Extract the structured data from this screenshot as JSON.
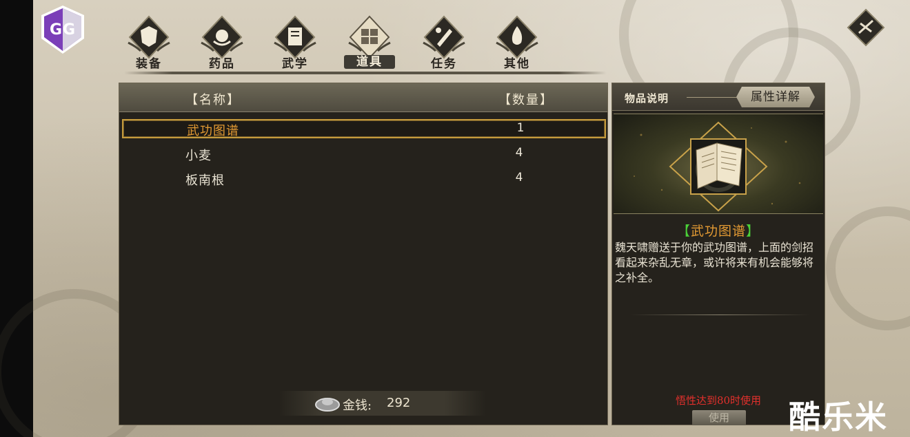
{
  "overlay": {
    "gg_label": "GG"
  },
  "tabs": [
    {
      "label": "装备",
      "icon": "armor-icon",
      "active": false
    },
    {
      "label": "药品",
      "icon": "medicine-icon",
      "active": false
    },
    {
      "label": "武学",
      "icon": "book-icon",
      "active": false
    },
    {
      "label": "道具",
      "icon": "item-box-icon",
      "active": true
    },
    {
      "label": "任务",
      "icon": "scroll-icon",
      "active": false
    },
    {
      "label": "其他",
      "icon": "flame-icon",
      "active": false
    }
  ],
  "list": {
    "name_header": "【名称】",
    "qty_header": "【数量】",
    "rows": [
      {
        "name": "武功图谱",
        "qty": "1",
        "selected": true
      },
      {
        "name": "小麦",
        "qty": "4",
        "selected": false
      },
      {
        "name": "板南根",
        "qty": "4",
        "selected": false
      }
    ]
  },
  "money": {
    "label": "金钱:",
    "value": "292"
  },
  "detail": {
    "tab_desc": "物品说明",
    "tab_attr": "属性详解",
    "item_name": "武功图谱",
    "bracket_left": "【",
    "bracket_right": "】",
    "description": "魏天啸赠送于你的武功图谱，上面的剑招看起来杂乱无章，或许将来有机会能够将之补全。",
    "requirement": "悟性达到80时使用",
    "use_label": "使用"
  },
  "watermark": "酷乐米",
  "colors": {
    "accent_orange": "#e39a33",
    "bracket_green": "#4bd038",
    "requirement_red": "#e3302c",
    "gg_purple": "#7b3fb8"
  }
}
